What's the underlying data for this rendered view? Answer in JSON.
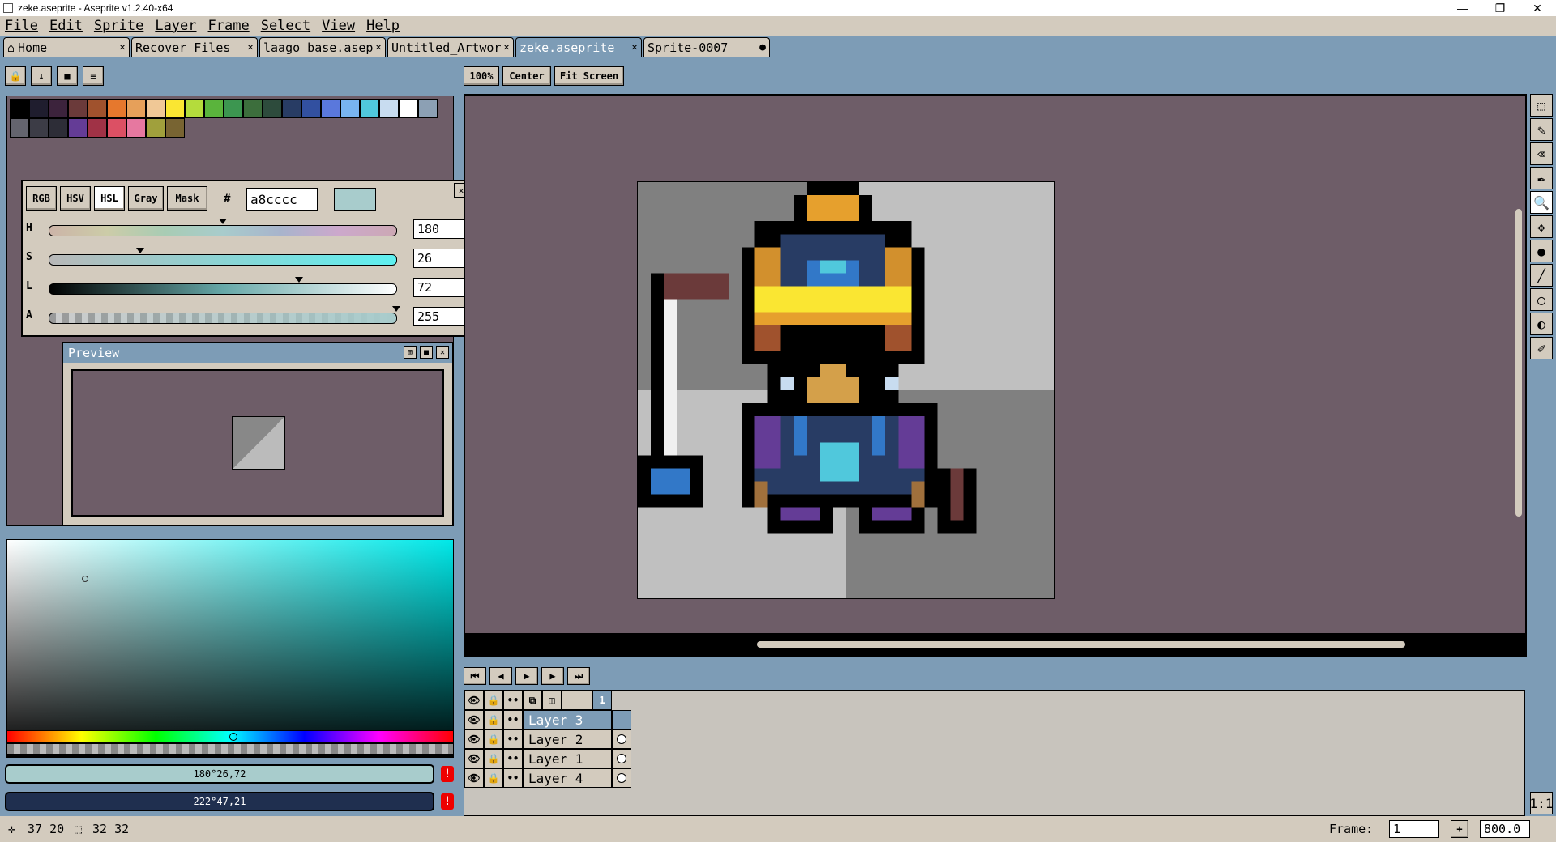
{
  "window": {
    "title": "zeke.aseprite - Aseprite v1.2.40-x64",
    "min": "—",
    "max": "❐",
    "close": "✕"
  },
  "menu": [
    "File",
    "Edit",
    "Sprite",
    "Layer",
    "Frame",
    "Select",
    "View",
    "Help"
  ],
  "tabs": [
    {
      "label": "Home",
      "close": "✕"
    },
    {
      "label": "Recover Files",
      "close": "✕"
    },
    {
      "label": "laago base.asep",
      "close": "✕"
    },
    {
      "label": "Untitled_Artwor",
      "close": "✕"
    },
    {
      "label": "zeke.aseprite",
      "close": "✕"
    },
    {
      "label": "Sprite-0007",
      "close": "●"
    }
  ],
  "view_buttons": {
    "zoom": "100%",
    "center": "Center",
    "fit": "Fit Screen"
  },
  "palette": {
    "colors": [
      "#000000",
      "#1f1d2e",
      "#3c233c",
      "#6b3a3a",
      "#a0522d",
      "#e6782d",
      "#e6a05a",
      "#f0c896",
      "#fae632",
      "#b4dc3c",
      "#5ab43c",
      "#3c9650",
      "#3c6e3c",
      "#2d4b3c",
      "#283c64",
      "#3250a0",
      "#5a78dc",
      "#78b4f0",
      "#50c8dc",
      "#c8dcf0",
      "#ffffff",
      "#8ca0b4",
      "#64646e",
      "#3c3c46",
      "#2d2d37",
      "#643c96",
      "#a03246",
      "#dc5064",
      "#e678a0",
      "#a0a03c",
      "#786432"
    ]
  },
  "color_panel": {
    "modes": [
      "RGB",
      "HSV",
      "HSL",
      "Gray",
      "Mask"
    ],
    "hash": "#",
    "hex": "a8cccc",
    "swatch": "#a8cccc",
    "close": "✕",
    "sliders": [
      {
        "label": "H",
        "value": "180"
      },
      {
        "label": "S",
        "value": "26"
      },
      {
        "label": "L",
        "value": "72"
      },
      {
        "label": "A",
        "value": "255"
      }
    ]
  },
  "preview": {
    "title": "Preview"
  },
  "fg_color": {
    "text": "180°26,72",
    "bg": "#a8cccc"
  },
  "bg_color": {
    "text": "222°47,21",
    "bg": "#1f2f4f"
  },
  "warn": "!",
  "timeline": {
    "frame_number": "1",
    "layers": [
      {
        "name": "Layer 3",
        "selected": true
      },
      {
        "name": "Layer 2",
        "selected": false
      },
      {
        "name": "Layer 1",
        "selected": false
      },
      {
        "name": "Layer 4",
        "selected": false
      }
    ]
  },
  "status": {
    "pos_label": "37 20",
    "size_label": "32 32",
    "frame_label": "Frame:",
    "frame_value": "1",
    "zoom_value": "800.0",
    "ratio": "1:1"
  }
}
